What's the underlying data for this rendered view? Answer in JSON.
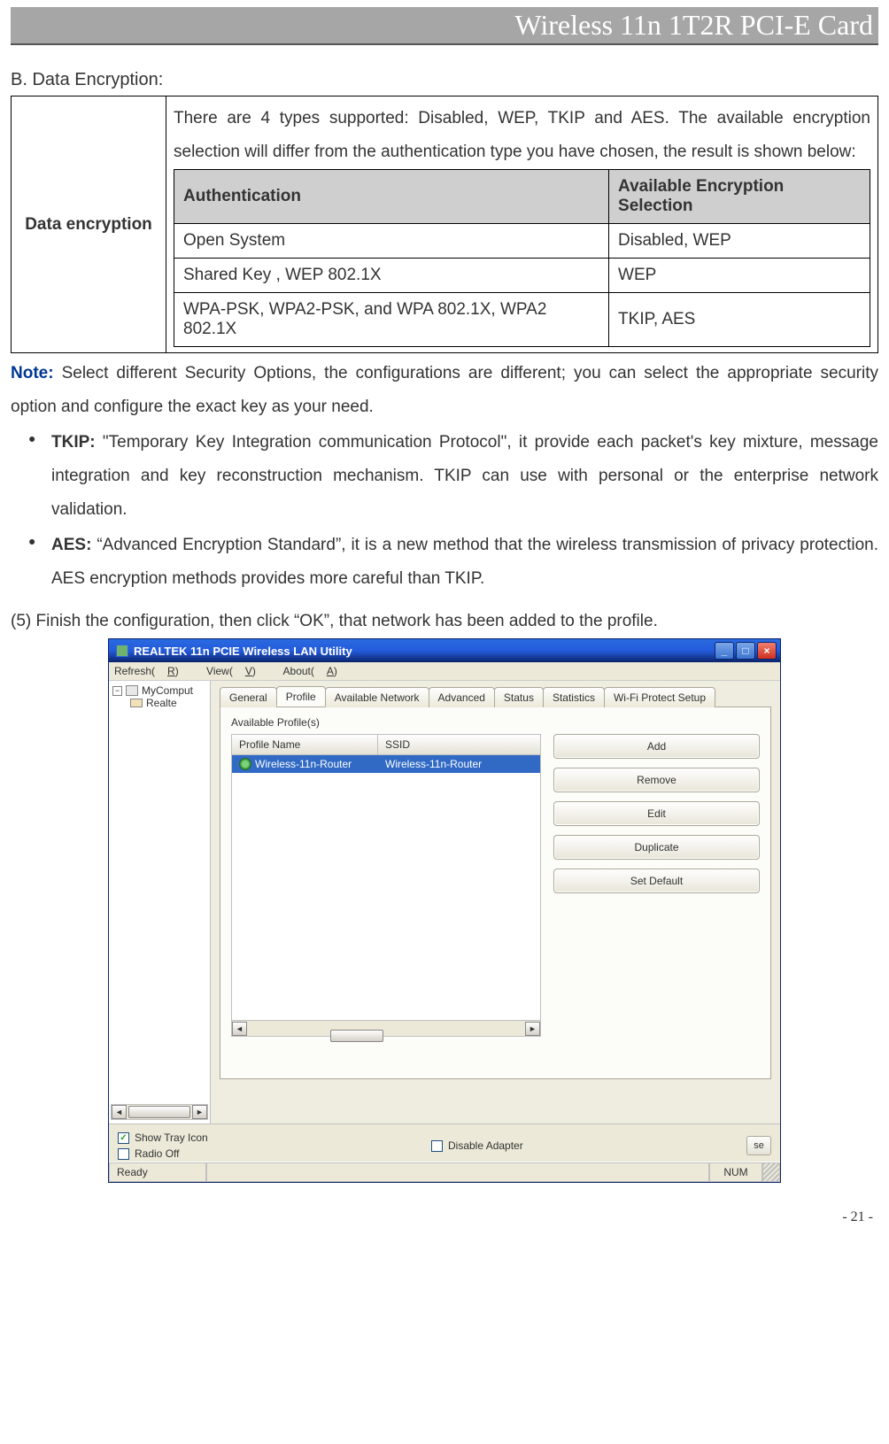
{
  "header": {
    "title": "Wireless 11n 1T2R PCI-E Card"
  },
  "section_b": "B. Data Encryption:",
  "outer_table": {
    "row_label": "Data encryption",
    "intro": "There are 4 types supported: Disabled, WEP, TKIP and AES. The available encryption selection will differ from the authentication type you have chosen, the result is shown below:",
    "headers": {
      "auth": "Authentication",
      "enc": "Available Encryption Selection"
    },
    "rows": [
      {
        "auth": "Open System",
        "enc": "Disabled, WEP"
      },
      {
        "auth": "Shared Key , WEP 802.1X",
        "enc": "WEP"
      },
      {
        "auth": "WPA-PSK, WPA2-PSK, and WPA 802.1X, WPA2 802.1X",
        "enc": "TKIP, AES"
      }
    ]
  },
  "note": {
    "label": "Note:",
    "text": " Select different Security Options, the configurations are different; you can select the appropriate security option and configure the exact key as your need."
  },
  "bullets": {
    "tkip_label": "TKIP: ",
    "tkip_text": "\"Temporary Key Integration communication Protocol\", it provide each packet's key mixture, message integration and key reconstruction mechanism. TKIP can use with personal or the enterprise network validation.",
    "aes_label": "AES: ",
    "aes_text": "“Advanced Encryption Standard”, it is a new method that the wireless transmission of privacy protection. AES encryption methods provides more careful than TKIP."
  },
  "step5": "(5) Finish the configuration, then click “OK”, that network has been added to the profile.",
  "app": {
    "title": "REALTEK 11n PCIE Wireless LAN Utility",
    "menu": {
      "refresh_pre": "Refresh(",
      "refresh_u": "R",
      "refresh_post": ")",
      "view_pre": "View(",
      "view_u": "V",
      "view_post": ")",
      "about_pre": "About(",
      "about_u": "A",
      "about_post": ")"
    },
    "tree": {
      "root": "MyComput",
      "child": "Realte"
    },
    "tabs": [
      "General",
      "Profile",
      "Available Network",
      "Advanced",
      "Status",
      "Statistics",
      "Wi-Fi Protect Setup"
    ],
    "active_tab_index": 1,
    "available_label": "Available Profile(s)",
    "list_headers": {
      "name": "Profile Name",
      "ssid": "SSID"
    },
    "profile_row": {
      "name": "Wireless-11n-Router",
      "ssid": "Wireless-11n-Router"
    },
    "buttons": [
      "Add",
      "Remove",
      "Edit",
      "Duplicate",
      "Set Default"
    ],
    "footer": {
      "show_tray": "Show Tray Icon",
      "radio_off": "Radio Off",
      "disable_adapter": "Disable Adapter",
      "partial_btn": "se",
      "checked": {
        "show_tray": true,
        "radio_off": false,
        "disable_adapter": false
      }
    },
    "status": {
      "ready": "Ready",
      "num": "NUM"
    }
  },
  "page_number": "- 21 -"
}
